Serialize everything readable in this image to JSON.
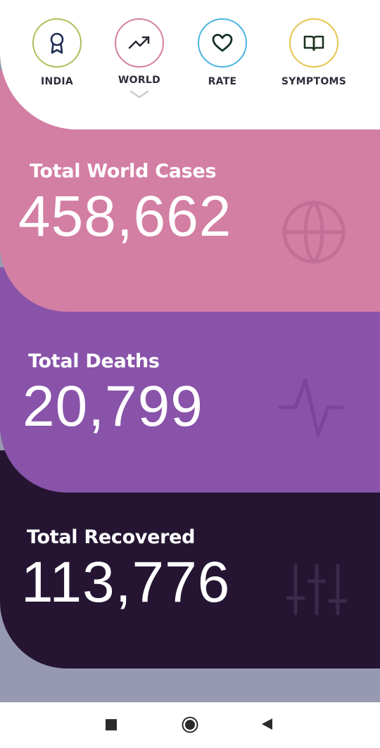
{
  "nav": {
    "items": [
      {
        "label": "INDIA",
        "icon": "award-icon",
        "ring": "#a9c25a"
      },
      {
        "label": "WORLD",
        "icon": "trending-up-icon",
        "ring": "#d47fa0",
        "active": true
      },
      {
        "label": "RATE",
        "icon": "heart-icon",
        "ring": "#4bb3df"
      },
      {
        "label": "SYMPTOMS",
        "icon": "book-icon",
        "ring": "#e4c54c"
      }
    ]
  },
  "stats": {
    "cases": {
      "title": "Total World Cases",
      "value": "458,662",
      "icon": "globe-icon",
      "color": "#d37ea3"
    },
    "deaths": {
      "title": "Total Deaths",
      "value": "20,799",
      "icon": "activity-icon",
      "color": "#8853a9"
    },
    "recovered": {
      "title": "Total Recovered",
      "value": "113,776",
      "icon": "sliders-icon",
      "color": "#251532"
    }
  },
  "system_nav": {
    "buttons": [
      "recents-square-icon",
      "home-circle-icon",
      "back-triangle-icon"
    ]
  }
}
